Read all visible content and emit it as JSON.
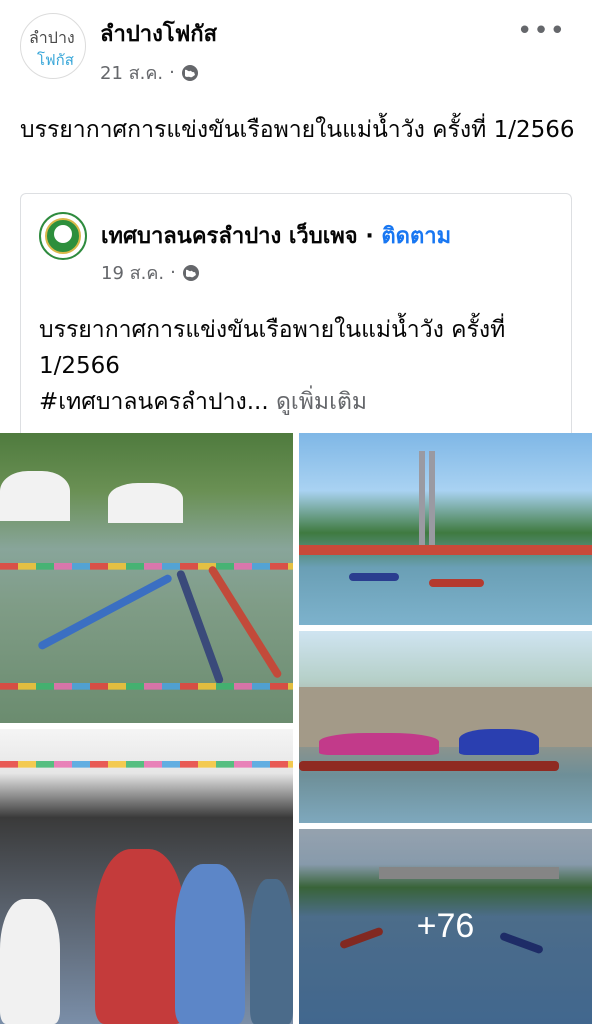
{
  "post": {
    "avatar_line1": "ลำปาง",
    "avatar_line2": "โฟกัส",
    "page_name": "ลำปางโฟกัส",
    "date": "21 ส.ค.",
    "dot": "·",
    "more_icon_text": "•••",
    "text": "บรรยากาศการแข่งขันเรือพายในแม่น้ำวัง ครั้งที่ 1/2566"
  },
  "shared": {
    "page_name": "เทศบาลนครลำปาง เว็บเพจ",
    "dot": "·",
    "follow_label": "ติดตาม",
    "date": "19 ส.ค.",
    "meta_dot": "·",
    "text_line1": "บรรยากาศการแข่งขันเรือพายในแม่น้ำวัง ครั้งที่",
    "text_line2": "1/2566",
    "text_line3": "#เทศบาลนครลำปาง...",
    "see_more_label": "ดูเพิ่มเติม"
  },
  "gallery": {
    "more_count": "+76"
  },
  "icons": {
    "audience": "globe-icon",
    "more": "more-options-icon"
  },
  "colors": {
    "link": "#1877f2",
    "secondary_text": "#65676b"
  }
}
